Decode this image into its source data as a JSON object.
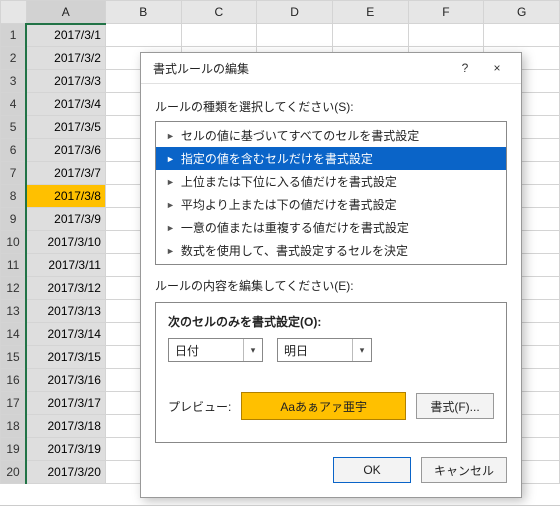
{
  "sheet": {
    "columns": [
      "A",
      "B",
      "C",
      "D",
      "E",
      "F",
      "G"
    ],
    "rows": [
      {
        "n": 1,
        "a": "2017/3/1"
      },
      {
        "n": 2,
        "a": "2017/3/2"
      },
      {
        "n": 3,
        "a": "2017/3/3"
      },
      {
        "n": 4,
        "a": "2017/3/4"
      },
      {
        "n": 5,
        "a": "2017/3/5"
      },
      {
        "n": 6,
        "a": "2017/3/6"
      },
      {
        "n": 7,
        "a": "2017/3/7"
      },
      {
        "n": 8,
        "a": "2017/3/8",
        "highlighted": true
      },
      {
        "n": 9,
        "a": "2017/3/9"
      },
      {
        "n": 10,
        "a": "2017/3/10"
      },
      {
        "n": 11,
        "a": "2017/3/11"
      },
      {
        "n": 12,
        "a": "2017/3/12"
      },
      {
        "n": 13,
        "a": "2017/3/13"
      },
      {
        "n": 14,
        "a": "2017/3/14"
      },
      {
        "n": 15,
        "a": "2017/3/15"
      },
      {
        "n": 16,
        "a": "2017/3/16"
      },
      {
        "n": 17,
        "a": "2017/3/17"
      },
      {
        "n": 18,
        "a": "2017/3/18"
      },
      {
        "n": 19,
        "a": "2017/3/19"
      },
      {
        "n": 20,
        "a": "2017/3/20"
      }
    ]
  },
  "dialog": {
    "title": "書式ルールの編集",
    "help_tip": "?",
    "close_tip": "×",
    "ruleTypeLabel": "ルールの種類を選択してください(S):",
    "ruleTypes": [
      "セルの値に基づいてすべてのセルを書式設定",
      "指定の値を含むセルだけを書式設定",
      "上位または下位に入る値だけを書式設定",
      "平均より上または下の値だけを書式設定",
      "一意の値または重複する値だけを書式設定",
      "数式を使用して、書式設定するセルを決定"
    ],
    "ruleTypeSelectedIndex": 1,
    "editLabel": "ルールの内容を編集してください(E):",
    "panelTitle": "次のセルのみを書式設定(O):",
    "operand1": "日付",
    "operand2": "明日",
    "previewLabel": "プレビュー:",
    "previewSample": "Aaあぁアァ亜宇",
    "formatButton": "書式(F)...",
    "ok": "OK",
    "cancel": "キャンセル"
  }
}
